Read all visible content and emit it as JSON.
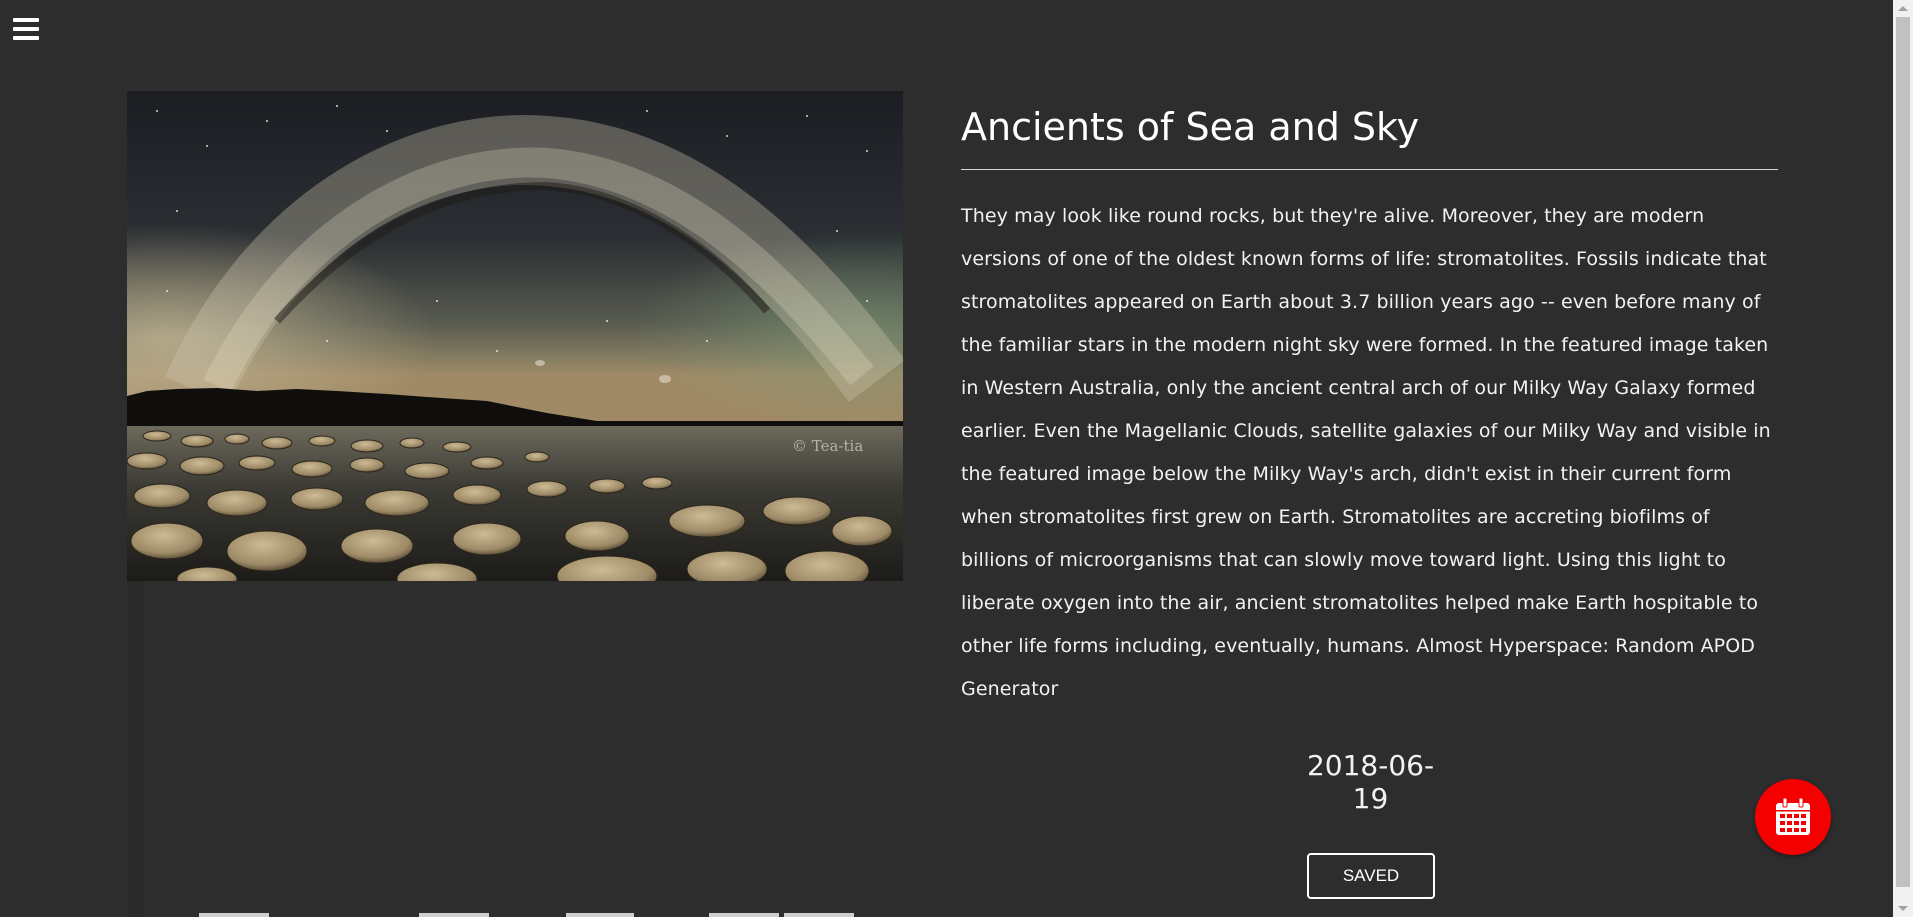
{
  "menu": {
    "icon": "hamburger-icon"
  },
  "apod": {
    "title": "Ancients of Sea and Sky",
    "explanation": "They may look like round rocks, but they're alive. Moreover, they are modern versions of one of the oldest known forms of life: stromatolites. Fossils indicate that stromatolites appeared on Earth about 3.7 billion years ago -- even before many of the familiar stars in the modern night sky were formed. In the featured image taken in Western Australia, only the ancient central arch of our Milky Way Galaxy formed earlier. Even the Magellanic Clouds, satellite galaxies of our Milky Way and visible in the featured image below the Milky Way's arch, didn't exist in their current form when stromatolites first grew on Earth. Stromatolites are accreting biofilms of billions of microorganisms that can slowly move toward light. Using this light to liberate oxygen into the air, ancient stromatolites helped make Earth hospitable to other life forms including, eventually, humans. Almost Hyperspace: Random APOD Generator",
    "date": "2018-06-19",
    "image_credit": "© Tea-tia"
  },
  "actions": {
    "saved_label": "SAVED",
    "calendar_icon": "calendar-icon"
  },
  "colors": {
    "background": "#2d2d2d",
    "fab": "#f50000",
    "text": "#ffffff"
  }
}
